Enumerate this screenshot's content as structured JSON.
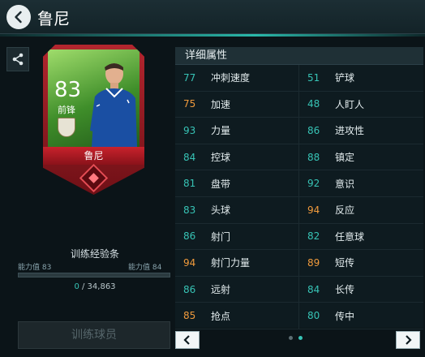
{
  "header": {
    "title": "鲁尼"
  },
  "card": {
    "rating": "83",
    "position": "前锋",
    "name": "鲁尼"
  },
  "training": {
    "title": "训练经验条",
    "left_label": "能力值",
    "left_value": "83",
    "right_label": "能力值",
    "right_value": "84",
    "current": "0",
    "separator": " / ",
    "total": "34,863",
    "progress_fraction": 0.0,
    "button_label": "训练球员"
  },
  "attributes": {
    "title": "详细属性",
    "rows": [
      [
        {
          "value": "77",
          "name": "冲刺速度",
          "color": "#37c3b5"
        },
        {
          "value": "51",
          "name": "铲球",
          "color": "#37c3b5"
        }
      ],
      [
        {
          "value": "75",
          "name": "加速",
          "color": "#f09a3c"
        },
        {
          "value": "48",
          "name": "人盯人",
          "color": "#37c3b5"
        }
      ],
      [
        {
          "value": "93",
          "name": "力量",
          "color": "#37c3b5"
        },
        {
          "value": "86",
          "name": "进攻性",
          "color": "#37c3b5"
        }
      ],
      [
        {
          "value": "84",
          "name": "控球",
          "color": "#37c3b5"
        },
        {
          "value": "88",
          "name": "镇定",
          "color": "#37c3b5"
        }
      ],
      [
        {
          "value": "81",
          "name": "盘带",
          "color": "#37c3b5"
        },
        {
          "value": "92",
          "name": "意识",
          "color": "#37c3b5"
        }
      ],
      [
        {
          "value": "83",
          "name": "头球",
          "color": "#37c3b5"
        },
        {
          "value": "94",
          "name": "反应",
          "color": "#f09a3c"
        }
      ],
      [
        {
          "value": "86",
          "name": "射门",
          "color": "#37c3b5"
        },
        {
          "value": "82",
          "name": "任意球",
          "color": "#37c3b5"
        }
      ],
      [
        {
          "value": "94",
          "name": "射门力量",
          "color": "#f09a3c"
        },
        {
          "value": "89",
          "name": "短传",
          "color": "#f09a3c"
        }
      ],
      [
        {
          "value": "86",
          "name": "远射",
          "color": "#37c3b5"
        },
        {
          "value": "84",
          "name": "长传",
          "color": "#37c3b5"
        }
      ],
      [
        {
          "value": "85",
          "name": "抢点",
          "color": "#f09a3c"
        },
        {
          "value": "80",
          "name": "传中",
          "color": "#37c3b5"
        }
      ]
    ]
  },
  "pager": {
    "prev": "‹",
    "next": "›",
    "page_count": 2,
    "active_page": 2
  },
  "colors": {
    "accent": "#37c3b5",
    "highlight": "#f09a3c",
    "card_red": "#b3262e"
  },
  "icons": [
    "back-icon",
    "share-icon",
    "club-crest-icon",
    "gem-icon"
  ]
}
